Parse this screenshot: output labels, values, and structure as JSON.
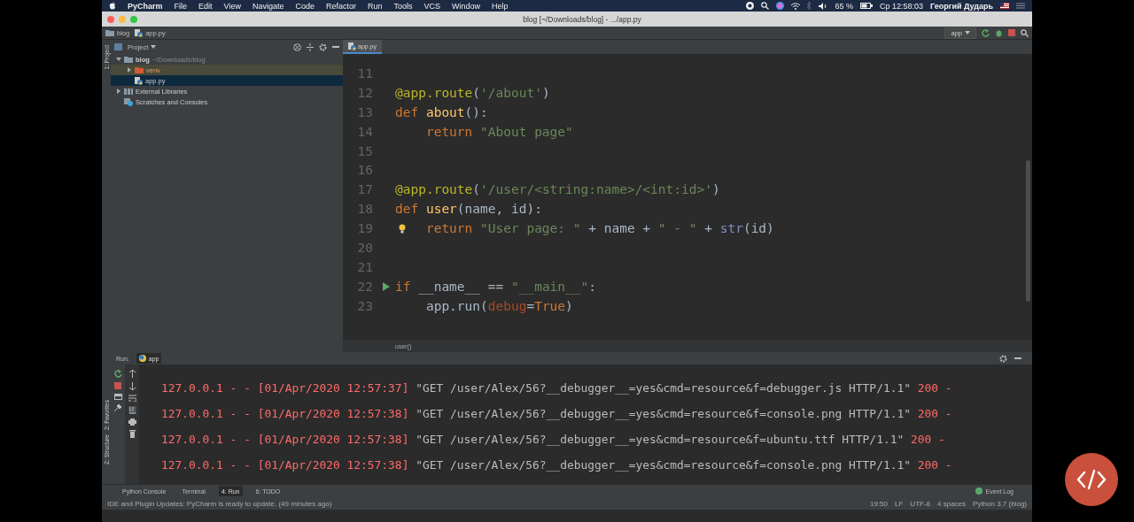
{
  "menu_bar": {
    "app": "PyCharm",
    "items": [
      "File",
      "Edit",
      "View",
      "Navigate",
      "Code",
      "Refactor",
      "Run",
      "Tools",
      "VCS",
      "Window",
      "Help"
    ],
    "battery": "65 %",
    "clock": "Ср 12:58:03",
    "user": "Георгий Дударь"
  },
  "window": {
    "title": "blog [~/Downloads/blog] - .../app.py"
  },
  "nav_bar": {
    "breadcrumbs": [
      "blog",
      "app.py"
    ],
    "run_config": "app"
  },
  "project": {
    "header": "Project",
    "side_tab": "1: Project",
    "tree": [
      {
        "label": "blog",
        "path": "~/Downloads/blog",
        "kind": "folder",
        "expanded": true,
        "selected": false,
        "children": [
          {
            "label": "venv",
            "kind": "excluded",
            "expanded": false,
            "selected": false
          },
          {
            "label": "app.py",
            "kind": "file",
            "selected": true
          }
        ]
      },
      {
        "label": "External Libraries",
        "kind": "library",
        "expanded": false,
        "selected": false
      },
      {
        "label": "Scratches and Consoles",
        "kind": "scratch",
        "selected": false
      }
    ]
  },
  "editor": {
    "tab": "app.py",
    "breadcrumb": "user()",
    "lines": [
      {
        "number": "11",
        "kind": "blank"
      },
      {
        "number": "12",
        "kind": "code",
        "tokens": [
          {
            "kind": "decorator",
            "text": "@app.route"
          },
          {
            "kind": "plain",
            "text": "("
          },
          {
            "kind": "string",
            "text": "'/about'"
          },
          {
            "kind": "plain",
            "text": ")"
          }
        ]
      },
      {
        "number": "13",
        "kind": "code",
        "tokens": [
          {
            "kind": "keyword",
            "text": "def "
          },
          {
            "kind": "func",
            "text": "about"
          },
          {
            "kind": "plain",
            "text": "():"
          }
        ]
      },
      {
        "number": "14",
        "kind": "code",
        "tokens": [
          {
            "kind": "keyword",
            "text": "    return "
          },
          {
            "kind": "string",
            "text": "\"About page\""
          }
        ]
      },
      {
        "number": "15",
        "kind": "blank"
      },
      {
        "number": "16",
        "kind": "blank"
      },
      {
        "number": "17",
        "kind": "code",
        "tokens": [
          {
            "kind": "decorator",
            "text": "@app.route"
          },
          {
            "kind": "plain",
            "text": "("
          },
          {
            "kind": "string",
            "text": "'/user/<string:name>/<int:id>'"
          },
          {
            "kind": "plain",
            "text": ")"
          }
        ]
      },
      {
        "number": "18",
        "kind": "code",
        "tokens": [
          {
            "kind": "keyword",
            "text": "def "
          },
          {
            "kind": "func",
            "text": "user"
          },
          {
            "kind": "plain",
            "text": "(name, id):"
          }
        ]
      },
      {
        "number": "19",
        "kind": "bulb",
        "tokens": [
          {
            "kind": "keyword",
            "text": "    return "
          },
          {
            "kind": "string",
            "text": "\"User page: \""
          },
          {
            "kind": "plain",
            "text": " + name + "
          },
          {
            "kind": "string",
            "text": "\" - \""
          },
          {
            "kind": "plain",
            "text": " + "
          },
          {
            "kind": "builtin",
            "text": "str"
          },
          {
            "kind": "plain",
            "text": "(id)"
          }
        ]
      },
      {
        "number": "20",
        "kind": "blank"
      },
      {
        "number": "21",
        "kind": "blank"
      },
      {
        "number": "22",
        "kind": "runnable",
        "tokens": [
          {
            "kind": "keyword",
            "text": "if "
          },
          {
            "kind": "plain",
            "text": "__name__ == "
          },
          {
            "kind": "string",
            "text": "\"__main__\""
          },
          {
            "kind": "plain",
            "text": ":"
          }
        ]
      },
      {
        "number": "23",
        "kind": "code",
        "tokens": [
          {
            "kind": "plain",
            "text": "    app.run("
          },
          {
            "kind": "param",
            "text": "debug"
          },
          {
            "kind": "plain",
            "text": "="
          },
          {
            "kind": "keyword",
            "text": "True"
          },
          {
            "kind": "plain",
            "text": ")"
          }
        ]
      }
    ]
  },
  "run_panel": {
    "label": "Run:",
    "tab": "app",
    "log": [
      [
        {
          "kind": "err",
          "text": "127.0.0.1 - - [01/Apr/2020 12:57:37] "
        },
        {
          "kind": "out",
          "text": "\"GET /user/Alex/56?__debugger__=yes&cmd=resource&f=debugger.js HTTP/1.1\""
        },
        {
          "kind": "err",
          "text": " 200 -"
        }
      ],
      [
        {
          "kind": "err",
          "text": "127.0.0.1 - - [01/Apr/2020 12:57:38] "
        },
        {
          "kind": "out",
          "text": "\"GET /user/Alex/56?__debugger__=yes&cmd=resource&f=console.png HTTP/1.1\""
        },
        {
          "kind": "err",
          "text": " 200 -"
        }
      ],
      [
        {
          "kind": "err",
          "text": "127.0.0.1 - - [01/Apr/2020 12:57:38] "
        },
        {
          "kind": "out",
          "text": "\"GET /user/Alex/56?__debugger__=yes&cmd=resource&f=ubuntu.ttf HTTP/1.1\""
        },
        {
          "kind": "err",
          "text": " 200 -"
        }
      ],
      [
        {
          "kind": "err",
          "text": "127.0.0.1 - - [01/Apr/2020 12:57:38] "
        },
        {
          "kind": "out",
          "text": "\"GET /user/Alex/56?__debugger__=yes&cmd=resource&f=console.png HTTP/1.1\""
        },
        {
          "kind": "err",
          "text": " 200 -"
        }
      ]
    ]
  },
  "side_tabs": [
    "2: Favorites",
    "Z: Structure"
  ],
  "tool_tabs": [
    {
      "label": "Python Console",
      "selected": false
    },
    {
      "label": "Terminal",
      "selected": false
    },
    {
      "label": "4: Run",
      "selected": true
    },
    {
      "label": "6: TODO",
      "selected": false
    }
  ],
  "event_log": "Event Log",
  "status_bar": {
    "message": "IDE and Plugin Updates: PyCharm is ready to update. (49 minutes ago)",
    "items": [
      "19:50",
      "LF",
      "UTF-8",
      "4 spaces",
      "Python 3.7 (blog)"
    ]
  }
}
